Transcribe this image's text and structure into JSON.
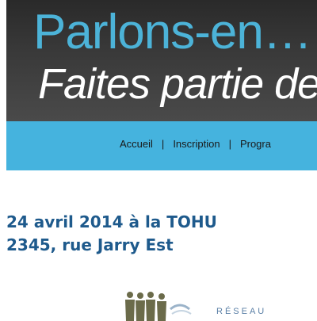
{
  "banner": {
    "title": "Parlons-en…",
    "subtitle": "Faites partie de"
  },
  "nav": {
    "items": [
      "Accueil",
      "Inscription",
      "Progra"
    ],
    "separator": "|"
  },
  "event": {
    "date_line": "24 avril 2014 à la TOHU",
    "address_line": "2345, rue Jarry Est"
  },
  "logo": {
    "text": "RÉSEAU"
  },
  "colors": {
    "banner_title": "#4cb3d8",
    "nav_background": "#45b3de",
    "event_text": "#1e5a8c",
    "logo_figures": "#6b6b4a"
  }
}
